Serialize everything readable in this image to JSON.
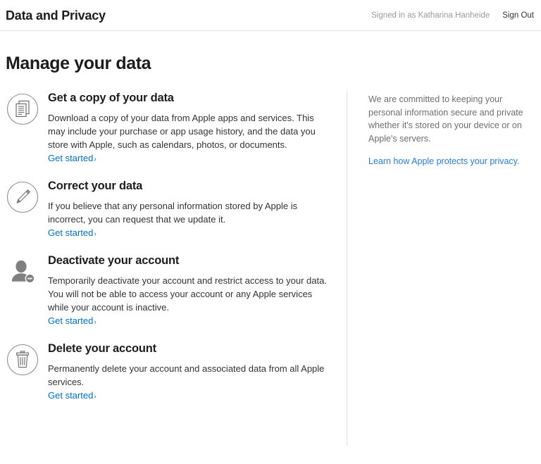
{
  "header": {
    "title": "Data and Privacy",
    "signed_in_text": "Signed in as Katharina Hanheide",
    "sign_out_label": "Sign Out"
  },
  "page": {
    "title": "Manage your data"
  },
  "sections": [
    {
      "icon": "documents-copy-icon",
      "title": "Get a copy of your data",
      "description": "Download a copy of your data from Apple apps and services. This may include your purchase or app usage history, and the data you store with Apple, such as calendars, photos, or documents.",
      "link_label": "Get started",
      "chevron": "›"
    },
    {
      "icon": "pencil-icon",
      "title": "Correct your data",
      "description": "If you believe that any personal information stored by Apple is incorrect, you can request that we update it.",
      "link_label": "Get started",
      "chevron": "›"
    },
    {
      "icon": "person-minus-icon",
      "title": "Deactivate your account",
      "description": "Temporarily deactivate your account and restrict access to your data. You will not be able to access your account or any Apple services while your account is inactive.",
      "link_label": "Get started",
      "chevron": "›"
    },
    {
      "icon": "trash-icon",
      "title": "Delete your account",
      "description": "Permanently delete your account and associated data from all Apple services.",
      "link_label": "Get started",
      "chevron": "›"
    }
  ],
  "aside": {
    "text": "We are committed to keeping your personal information secure and private whether it's stored on your device or on Apple's servers.",
    "link_label": "Learn how Apple protects your privacy.",
    "link_color": "#2b7bd6"
  },
  "colors": {
    "link": "#0070c9",
    "text": "#333336",
    "muted": "#6e6e73",
    "icon_gray": "#8e8e8e",
    "divider": "#e0e0e0"
  }
}
